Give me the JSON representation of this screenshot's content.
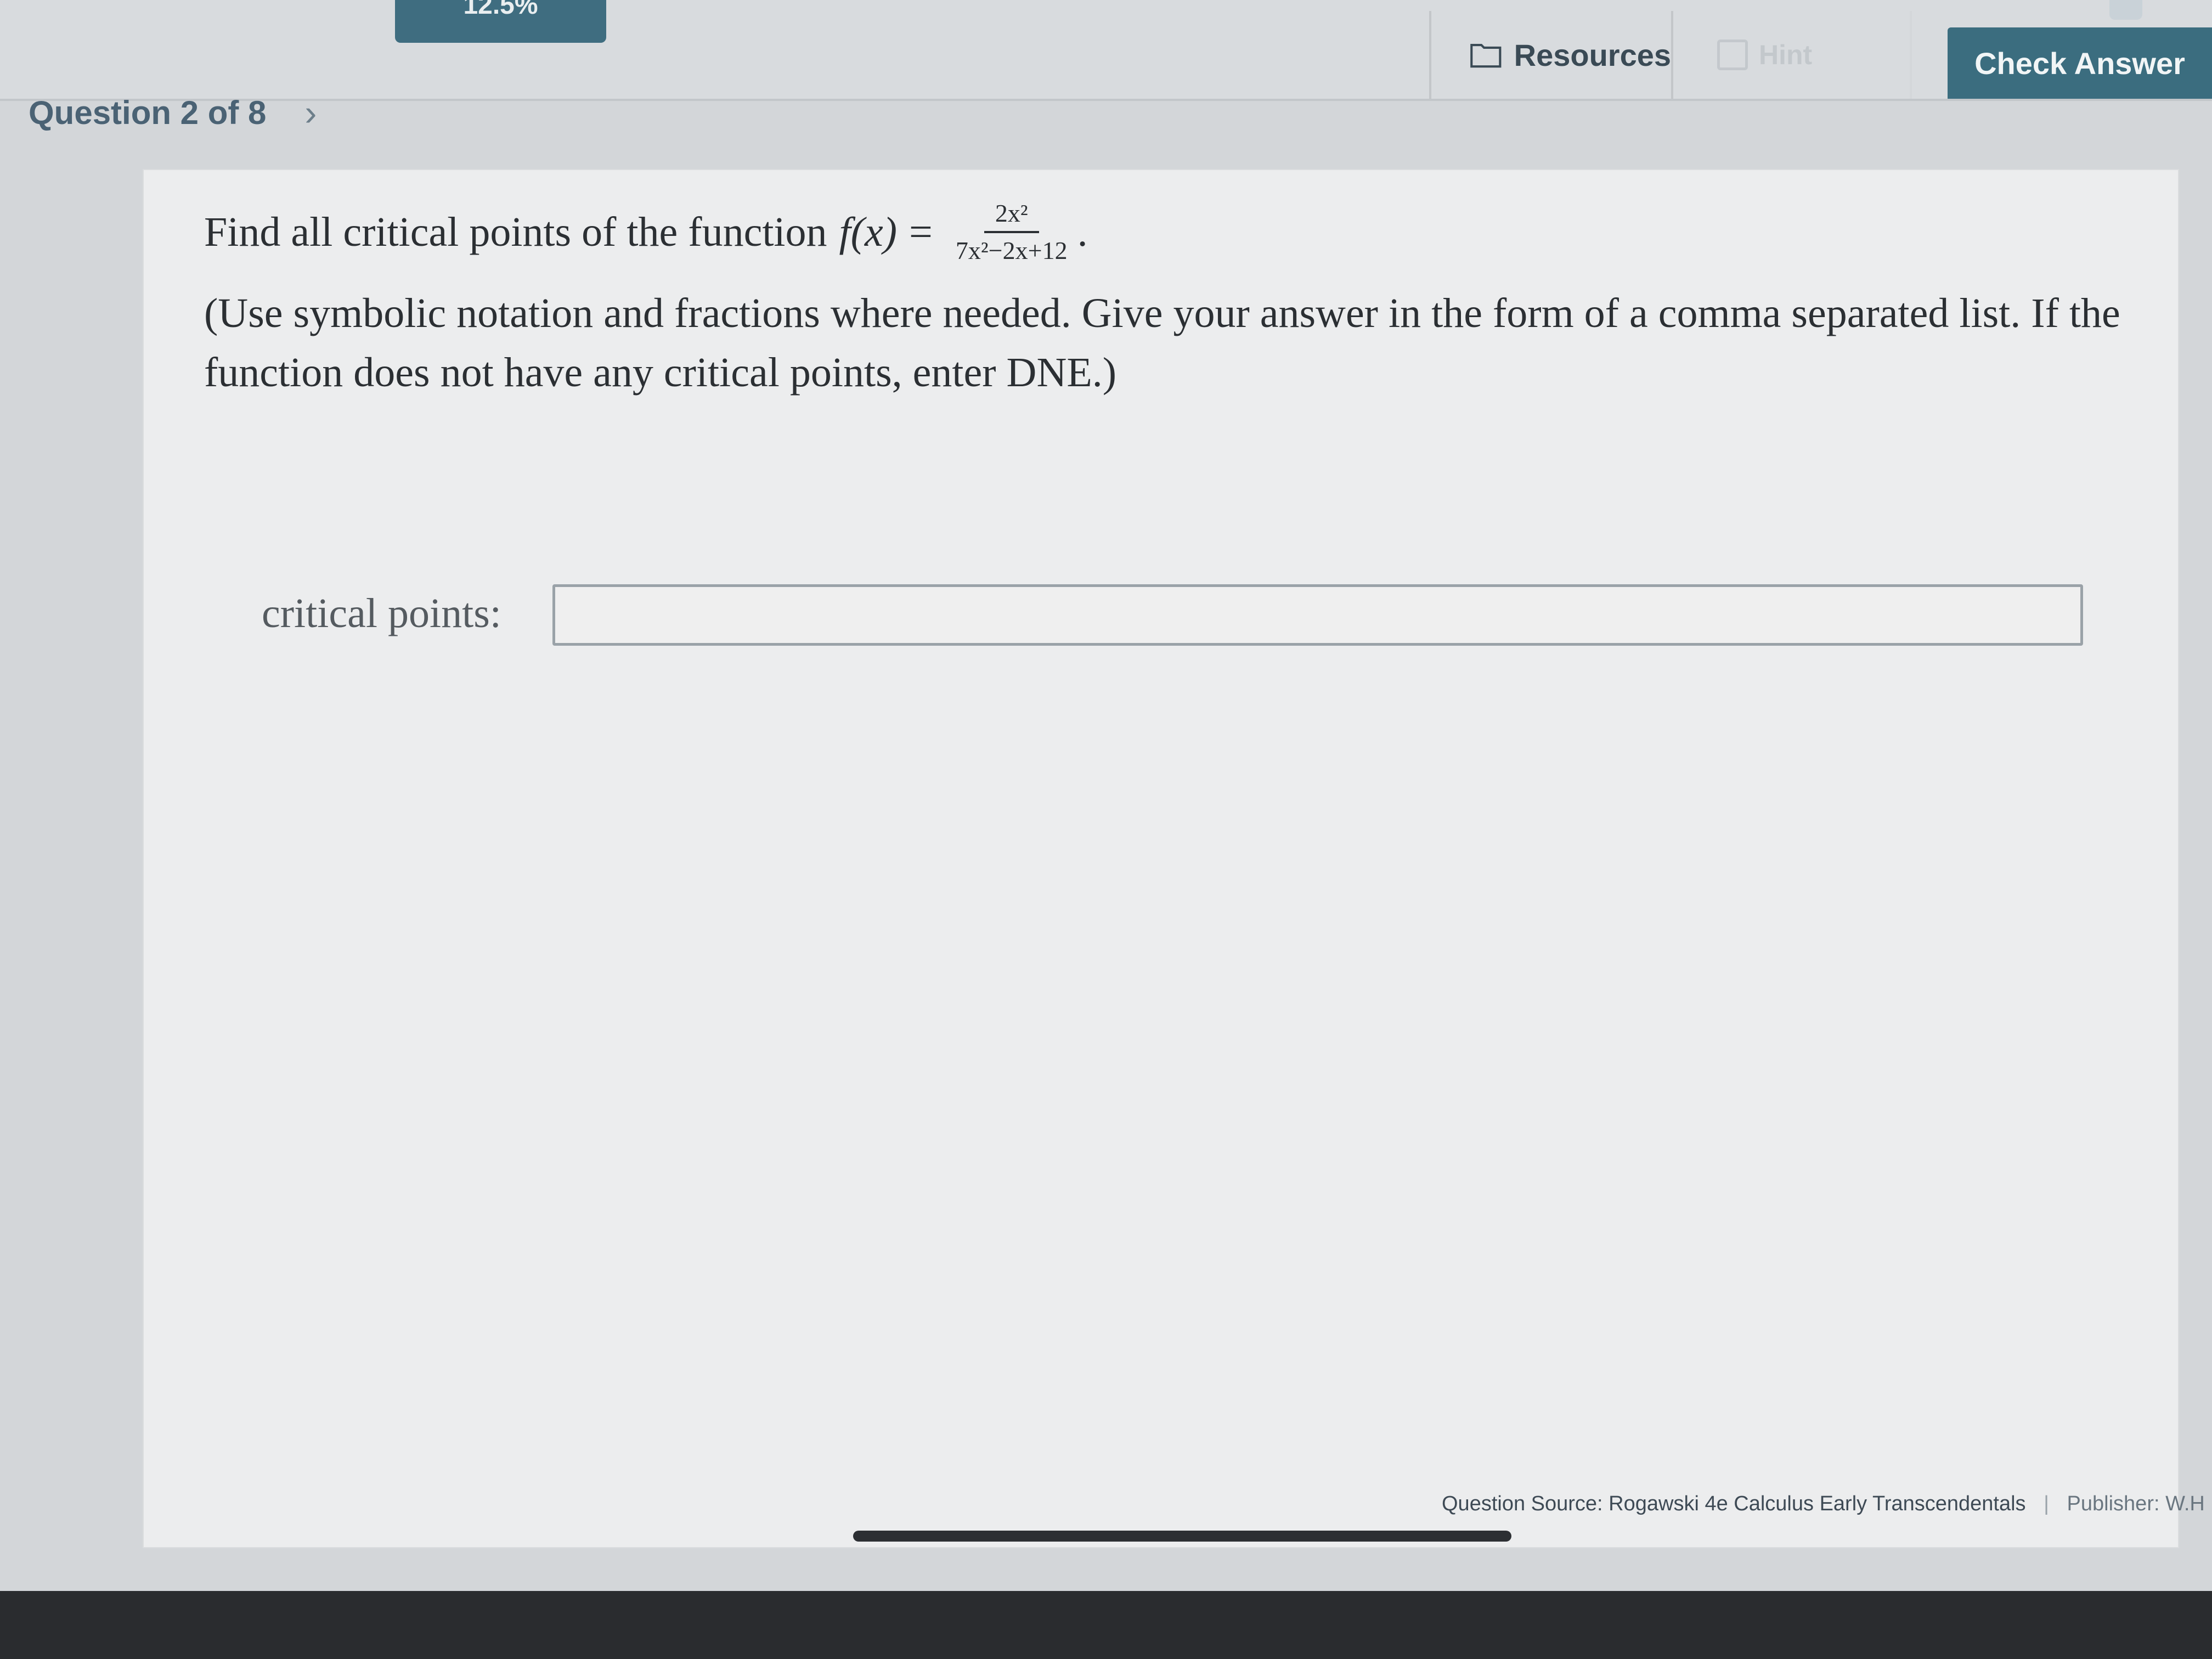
{
  "header": {
    "progress_text": "12.5%",
    "resources_label": "Resources",
    "hint_label": "Hint",
    "check_answer_label": "Check Answer"
  },
  "question_nav": {
    "label": "Question 2 of 8",
    "next_symbol": "›"
  },
  "question": {
    "intro": "Find all critical points of the function",
    "function_lhs": "f(x)",
    "equals": "=",
    "numerator": "2x²",
    "denominator": "7x²−2x+12",
    "period": ".",
    "instructions": "(Use symbolic notation and fractions where needed. Give your answer in the form of a comma separated list. If the function does not have any critical points, enter DNE.)"
  },
  "answer": {
    "label": "critical points:",
    "value": ""
  },
  "footer": {
    "source": "Question Source: Rogawski 4e Calculus Early Transcendentals",
    "separator": "|",
    "publisher": "Publisher: W.H"
  },
  "colors": {
    "accent": "#3b6d7f",
    "nav_text": "#4a6274"
  }
}
